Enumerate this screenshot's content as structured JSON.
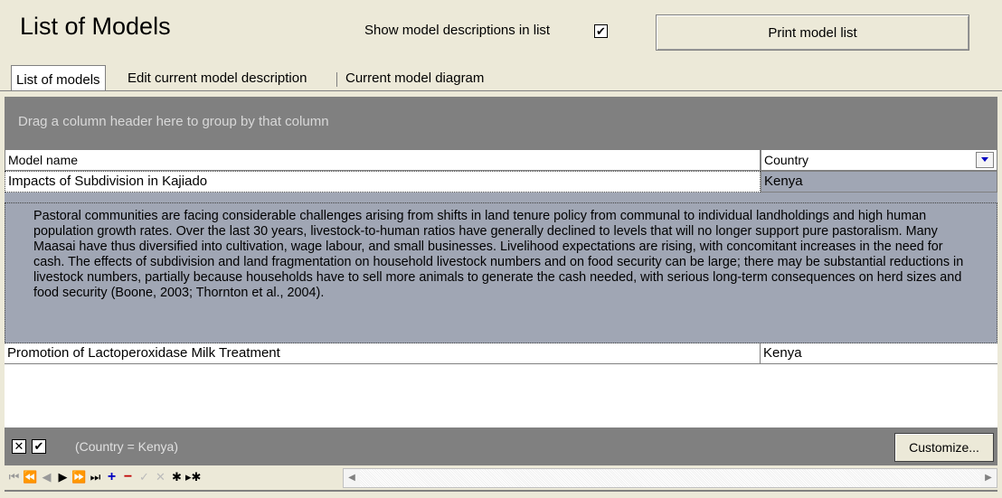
{
  "header": {
    "title": "List of Models",
    "show_desc_label": "Show model descriptions in list",
    "show_desc_checked": true,
    "print_button": "Print model list"
  },
  "tabs": [
    "List of models",
    "Edit current model description",
    "Current model diagram"
  ],
  "grid": {
    "group_hint": "Drag a column header here to group by that column",
    "columns": [
      "Model name",
      "Country"
    ],
    "rows": [
      {
        "name": "Impacts of Subdivision in Kajiado",
        "country": "Kenya",
        "description": "Pastoral communities are facing considerable challenges arising from shifts in land tenure policy from communal to individual landholdings and high human population growth rates.  Over the last 30 years, livestock-to-human ratios have generally declined to levels that will no longer support pure pastoralism.  Many Maasai have thus diversified into cultivation, wage labour, and small businesses.  Livelihood expectations are rising, with concomitant increases in the need for cash.  The effects of subdivision and land fragmentation on household livestock numbers and on food security can be large; there may be substantial reductions in livestock numbers, partially because households have to sell more animals to generate the cash needed,  with serious long-term consequences on herd sizes and food security (Boone, 2003; Thornton et al., 2004)."
      },
      {
        "name": "Promotion of Lactoperoxidase Milk Treatment",
        "country": "Kenya"
      }
    ],
    "filter_text": "(Country = Kenya)",
    "customize_button": "Customize..."
  },
  "colors": {
    "accent": "#0000c0",
    "desc_bg": "#a0a6b4",
    "panel_gray": "#808080"
  }
}
